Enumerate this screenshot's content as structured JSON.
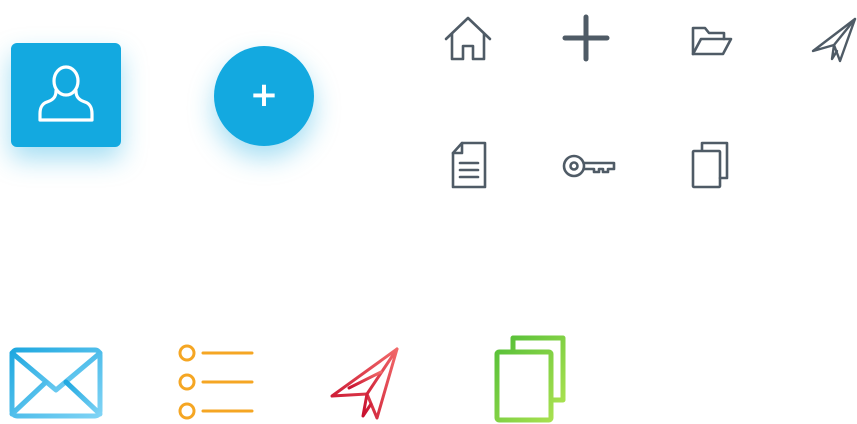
{
  "buttons": {
    "add_glyph": "+"
  },
  "icons": {
    "user": "user-icon",
    "add": "plus-icon",
    "toolbar_row_1": [
      "home-icon",
      "plus-icon",
      "folder-open-icon",
      "paper-plane-icon"
    ],
    "toolbar_row_2": [
      "document-icon",
      "key-icon",
      "copy-icon"
    ],
    "colored_row": [
      "mail-icon",
      "list-icon",
      "paper-plane-icon",
      "copy-icon"
    ]
  },
  "colors": {
    "accent_blue": "#13a9e0",
    "icon_gray": "#4f5b66",
    "mail_gradient": [
      "#1fa8e0",
      "#7fd3f5"
    ],
    "list_orange": "#f5a623",
    "plane_gradient": [
      "#c8102e",
      "#f16a6a"
    ],
    "copy_green": [
      "#5cc23a",
      "#a6e04f"
    ]
  }
}
